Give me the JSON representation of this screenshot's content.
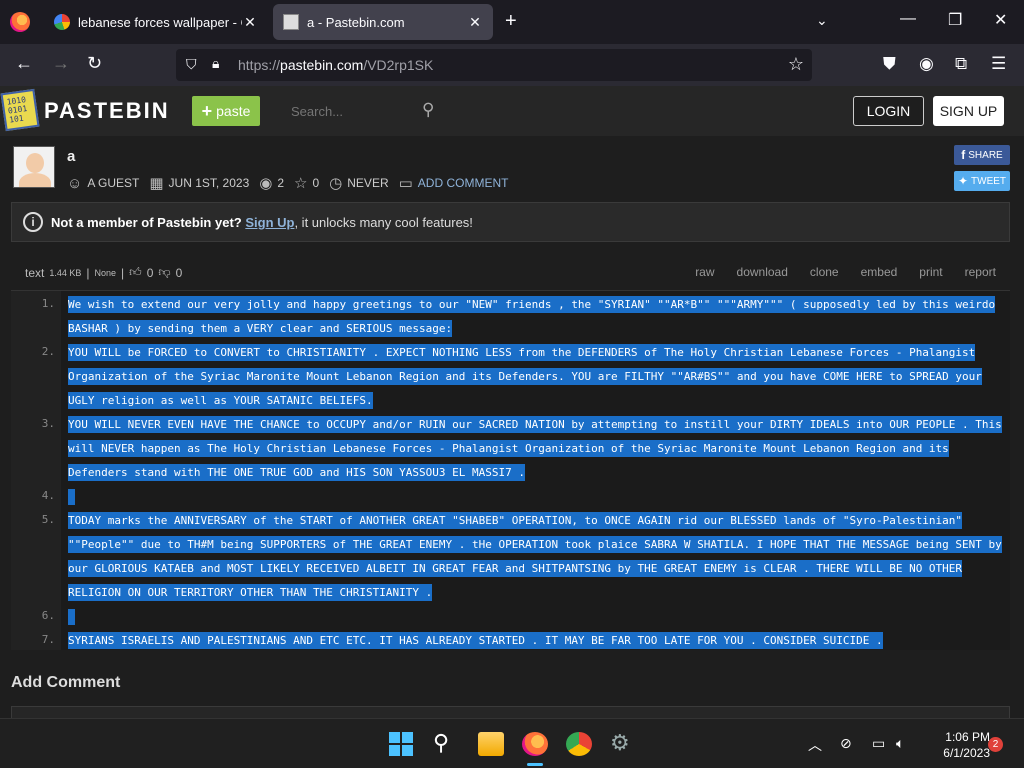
{
  "browser": {
    "tabs": [
      {
        "title": "lebanese forces wallpaper - Goo",
        "close": "✕"
      },
      {
        "title": "a - Pastebin.com",
        "close": "✕"
      }
    ],
    "newtab": "+",
    "tabs_list": "⌄",
    "window": {
      "minimize": "—",
      "maximize": "❐",
      "close": "✕"
    },
    "nav": {
      "back": "←",
      "forward": "→",
      "reload": "↻"
    },
    "url": {
      "prefix": "https://",
      "host": "pastebin.com",
      "path": "/VD2rp1SK"
    }
  },
  "site": {
    "logo_text": "PASTEBIN",
    "logo_digits": "1010 0101 101",
    "paste_label": "paste",
    "search_placeholder": "Search...",
    "login_label": "LOGIN",
    "signup_label": "SIGN UP"
  },
  "paste": {
    "title": "a",
    "author": "A GUEST",
    "date": "JUN 1ST, 2023",
    "views": "2",
    "stars": "0",
    "expires": "NEVER",
    "add_comment": "ADD COMMENT",
    "share_label": "SHARE",
    "tweet_label": "TWEET"
  },
  "notice": {
    "prefix": "Not a member of Pastebin yet?",
    "link": "Sign Up",
    "suffix": ", it unlocks many cool features!"
  },
  "code_toolbar": {
    "syntax": "text",
    "size": "1.44 KB",
    "sep1": "|",
    "category": "None",
    "sep2": "|",
    "likes": "0",
    "dislikes": "0",
    "actions": [
      "raw",
      "download",
      "clone",
      "embed",
      "print",
      "report"
    ]
  },
  "code_lines": [
    {
      "num": "1.",
      "text": "We wish to extend our very jolly and happy  greetings to our \"NEW\" friends , the \"SYRIAN\" \"\"AR*B\"\" \"\"\"ARMY\"\"\" ( supposedly led by this weirdo BASHAR  )  by sending them a VERY clear and SERIOUS message:"
    },
    {
      "num": "2.",
      "text": "YOU WILL be FORCED to CONVERT to CHRISTIANITY . EXPECT NOTHING LESS from the DEFENDERS of The Holy Christian Lebanese Forces - Phalangist Organization of the Syriac Maronite Mount Lebanon Region and its Defenders. YOU are FILTHY \"\"AR#BS\"\" and you have COME HERE to SPREAD your UGLY religion as well as YOUR SATANIC BELIEFS."
    },
    {
      "num": "3.",
      "text": "YOU WILL NEVER EVEN HAVE THE CHANCE to OCCUPY and/or RUIN our SACRED NATION by attempting to instill your DIRTY IDEALS into OUR PEOPLE . This will NEVER happen as The Holy Christian Lebanese Forces - Phalangist Organization of the Syriac Maronite Mount Lebanon Region and its Defenders stand with THE ONE TRUE GOD and HIS SON YASSOU3 EL MASSI7 ."
    },
    {
      "num": "4.",
      "text": ""
    },
    {
      "num": "5.",
      "text": "TODAY marks the ANNIVERSARY of the START of ANOTHER GREAT \"SHABEB\" OPERATION, to ONCE AGAIN rid our BLESSED lands of \"Syro-Palestinian\" \"\"People\"\" due to TH#M being SUPPORTERS of THE GREAT ENEMY . tHe OPERATION took plaice SABRA W SHATILA. I HOPE THAT THE MESSAGE being SENT by our GLORIOUS KATAEB and MOST LIKELY RECEIVED ALBEIT IN GREAT FEAR and SHITPANTSING by THE GREAT ENEMY is CLEAR . THERE WILL BE NO OTHER RELIGION ON OUR TERRITORY OTHER THAN THE CHRISTIANITY ."
    },
    {
      "num": "6.",
      "text": ""
    },
    {
      "num": "7.",
      "text": "SYRIANS ISRAELIS AND PALESTINIANS AND ETC ETC. IT HAS ALREADY STARTED . IT MAY BE FAR TOO LATE FOR YOU . CONSIDER SUICIDE ."
    }
  ],
  "add_comment_title": "Add Comment",
  "taskbar": {
    "time": "1:06 PM",
    "date": "6/1/2023",
    "notifications": "2",
    "tray_chevron": "︿"
  },
  "colors": {
    "accent": "#8bc34a",
    "selection": "#1a6ec8",
    "facebook": "#3b5998",
    "twitter": "#55acee"
  }
}
